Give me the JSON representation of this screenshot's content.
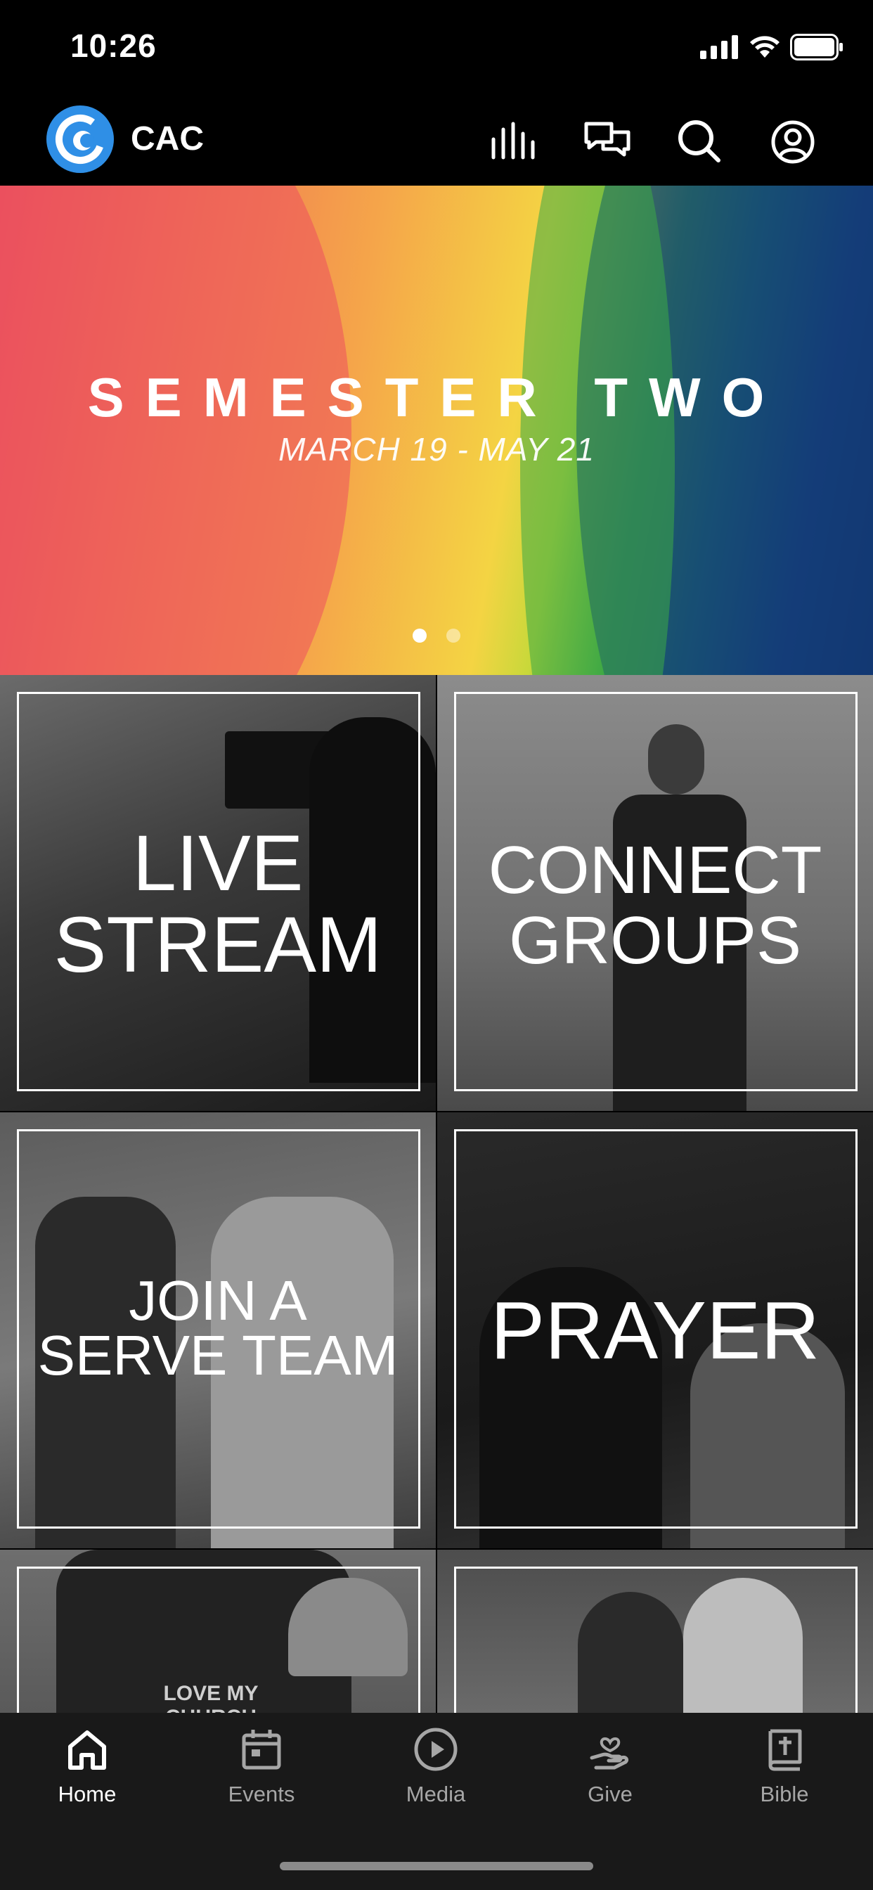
{
  "status_bar": {
    "time": "10:26"
  },
  "header": {
    "app_name": "CAC"
  },
  "banner": {
    "title": "SEMESTER TWO",
    "dates": "MARCH 19 - MAY 21",
    "slide_count": 2,
    "active_slide": 1
  },
  "tiles": [
    {
      "label_line1": "LIVE",
      "label_line2": "STREAM"
    },
    {
      "label_line1": "CONNECT",
      "label_line2": "GROUPS"
    },
    {
      "label_line1": "JOIN A",
      "label_line2": "SERVE TEAM"
    },
    {
      "label_line1": "PRAYER"
    },
    {
      "overlay_text": "LOVE MY CHURCH"
    },
    {}
  ],
  "tabbar": {
    "items": [
      {
        "label": "Home",
        "icon": "home-icon",
        "active": true
      },
      {
        "label": "Events",
        "icon": "calendar-icon",
        "active": false
      },
      {
        "label": "Media",
        "icon": "play-icon",
        "active": false
      },
      {
        "label": "Give",
        "icon": "give-icon",
        "active": false
      },
      {
        "label": "Bible",
        "icon": "bible-icon",
        "active": false
      }
    ]
  },
  "colors": {
    "accent": "#2f8fe6",
    "tabbar_bg": "#191919",
    "inactive_tab": "#a6a6a6"
  }
}
